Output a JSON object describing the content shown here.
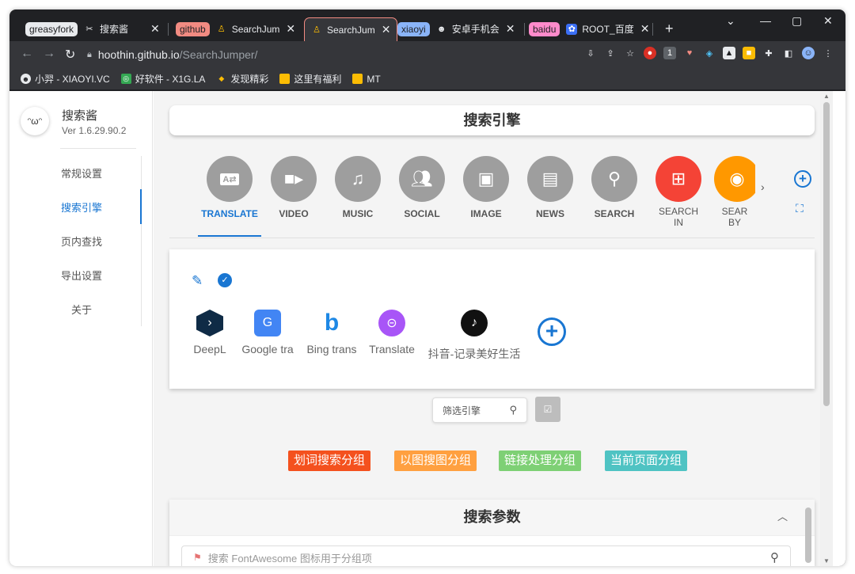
{
  "browser": {
    "tabs": [
      {
        "group": "greasyfork",
        "title": "搜索酱"
      },
      {
        "group": "github",
        "title": "SearchJum"
      },
      {
        "title": "SearchJum"
      },
      {
        "group": "xiaoyi",
        "title": "安卓手机会"
      },
      {
        "group": "baidu",
        "title": "ROOT_百度"
      }
    ],
    "new_tab": "+",
    "url_host": "hoothin.github.io",
    "url_path": "/SearchJumper/",
    "bookmarks": [
      "小羿 - XIAOYI.VC",
      "好软件 - X1G.LA",
      "发现精彩",
      "这里有福利",
      "MT"
    ]
  },
  "sidebar": {
    "app_name": "搜索酱",
    "version": "Ver 1.6.29.90.2",
    "items": [
      {
        "label": "常规设置"
      },
      {
        "label": "搜索引擎"
      },
      {
        "label": "页内查找"
      },
      {
        "label": "导出设置"
      },
      {
        "label": "关于"
      }
    ]
  },
  "main": {
    "title": "搜索引擎",
    "categories": [
      {
        "label": "TRANSLATE",
        "icon": "translate-icon",
        "color": "#9e9e9e"
      },
      {
        "label": "VIDEO",
        "icon": "video-icon",
        "color": "#9e9e9e"
      },
      {
        "label": "MUSIC",
        "icon": "music-icon",
        "color": "#9e9e9e"
      },
      {
        "label": "SOCIAL",
        "icon": "people-icon",
        "color": "#9e9e9e"
      },
      {
        "label": "IMAGE",
        "icon": "image-icon",
        "color": "#9e9e9e"
      },
      {
        "label": "NEWS",
        "icon": "newspaper-icon",
        "color": "#9e9e9e"
      },
      {
        "label": "SEARCH",
        "icon": "search-icon",
        "color": "#9e9e9e"
      },
      {
        "label": "SEARCH IN",
        "icon": "sitemap-icon",
        "color": "#f44336"
      },
      {
        "label": "SEAR BY",
        "icon": "eye-icon",
        "color": "#ff9800"
      }
    ],
    "engines": [
      {
        "label": "DeepL",
        "icon": "deepl-icon"
      },
      {
        "label": "Google tra",
        "icon": "google-translate-icon"
      },
      {
        "label": "Bing trans",
        "icon": "bing-icon"
      },
      {
        "label": "Translate",
        "icon": "translate-bot-icon"
      },
      {
        "label": "抖音-记录美好生活",
        "icon": "tiktok-icon"
      }
    ],
    "filter_placeholder": "筛选引擎",
    "groups": [
      {
        "label": "划词搜索分组",
        "color": "#f4511e"
      },
      {
        "label": "以图搜图分组",
        "color": "#ffa040"
      },
      {
        "label": "链接处理分组",
        "color": "#7ed075"
      },
      {
        "label": "当前页面分组",
        "color": "#4fc3c3"
      }
    ],
    "params_title": "搜索参数",
    "params_placeholder": "搜索 FontAwesome 图标用于分组项"
  }
}
